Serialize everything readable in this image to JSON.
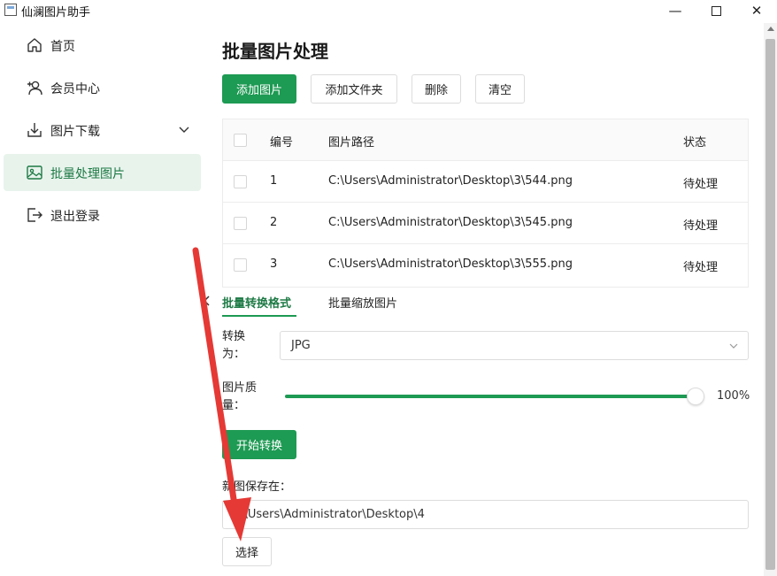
{
  "window": {
    "title": "仙澜图片助手",
    "minimize_glyph": "—",
    "maximize_glyph": "☐",
    "close_glyph": "✕"
  },
  "sidebar": {
    "items": [
      {
        "label": "首页",
        "icon": "home-icon"
      },
      {
        "label": "会员中心",
        "icon": "user-plus-icon"
      },
      {
        "label": "图片下载",
        "icon": "download-icon",
        "has_chevron": true
      },
      {
        "label": "批量处理图片",
        "icon": "image-icon",
        "active": true
      },
      {
        "label": "退出登录",
        "icon": "logout-icon"
      }
    ],
    "collapse_glyph": "‹"
  },
  "main": {
    "title": "批量图片处理",
    "toolbar": {
      "add_image": "添加图片",
      "add_folder": "添加文件夹",
      "delete": "删除",
      "clear": "清空"
    },
    "table": {
      "headers": {
        "num": "编号",
        "path": "图片路径",
        "status": "状态"
      },
      "rows": [
        {
          "num": "1",
          "path": "C:\\Users\\Administrator\\Desktop\\3\\544.png",
          "status": "待处理"
        },
        {
          "num": "2",
          "path": "C:\\Users\\Administrator\\Desktop\\3\\545.png",
          "status": "待处理"
        },
        {
          "num": "3",
          "path": "C:\\Users\\Administrator\\Desktop\\3\\555.png",
          "status": "待处理"
        }
      ]
    },
    "tabs": [
      {
        "label": "批量转换格式",
        "active": true
      },
      {
        "label": "批量缩放图片",
        "active": false
      }
    ],
    "convert": {
      "label_line1": "转换",
      "label_line2": "为：",
      "format_value": "JPG"
    },
    "quality": {
      "label_line1": "图片质",
      "label_line2": "量：",
      "value_text": "100%",
      "value": 100
    },
    "start_button": "开始转换",
    "save": {
      "label": "新图保存在：",
      "path": "C:\\Users\\Administrator\\Desktop\\4",
      "choose_button": "选择"
    }
  },
  "colors": {
    "primary": "#1d9a53",
    "active_nav_bg": "#e8f3ec",
    "annotation_arrow": "#e53935"
  }
}
